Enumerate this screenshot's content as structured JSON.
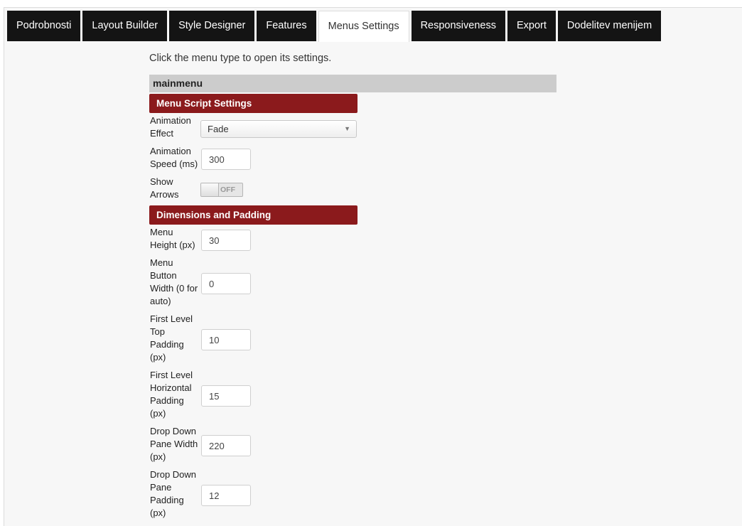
{
  "tabs": [
    {
      "label": "Podrobnosti",
      "active": false
    },
    {
      "label": "Layout Builder",
      "active": false
    },
    {
      "label": "Style Designer",
      "active": false
    },
    {
      "label": "Features",
      "active": false
    },
    {
      "label": "Menus Settings",
      "active": true
    },
    {
      "label": "Responsiveness",
      "active": false
    },
    {
      "label": "Export",
      "active": false
    },
    {
      "label": "Dodelitev menijem",
      "active": false
    }
  ],
  "intro_text": "Click the menu type to open its settings.",
  "menu_type": "mainmenu",
  "sections": {
    "script": {
      "title": "Menu Script Settings",
      "animation_effect": {
        "label": "Animation Effect",
        "value": "Fade"
      },
      "animation_speed": {
        "label": "Animation Speed (ms)",
        "value": "300"
      },
      "show_arrows": {
        "label": "Show Arrows",
        "state": "OFF"
      }
    },
    "dimensions": {
      "title": "Dimensions and Padding",
      "menu_height": {
        "label": "Menu Height (px)",
        "value": "30"
      },
      "button_width": {
        "label": "Menu Button Width (0 for auto)",
        "value": "0"
      },
      "top_padding": {
        "label": "First Level Top Padding (px)",
        "value": "10"
      },
      "horizontal_padding": {
        "label": "First Level Horizontal Padding (px)",
        "value": "15"
      },
      "pane_width": {
        "label": "Drop Down Pane Width (px)",
        "value": "220"
      },
      "pane_padding": {
        "label": "Drop Down Pane Padding (px)",
        "value": "12"
      }
    }
  },
  "colors": {
    "tab_bg": "#141414",
    "section_header_bg": "#8b1a1c",
    "menu_type_bar_bg": "#cccccc",
    "page_bg": "#f7f7f7"
  }
}
